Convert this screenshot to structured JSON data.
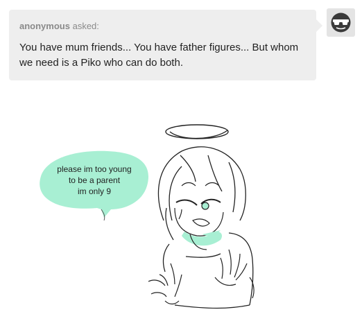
{
  "ask": {
    "asker": "anonymous",
    "asked_label": "asked:",
    "question": "You have mum friends... You have father figures... But whom we need is a Piko who can do both."
  },
  "answer": {
    "speech_lines": [
      "please im too young",
      "to be a parent",
      "im only 9"
    ]
  },
  "colors": {
    "ask_background": "#eeeeee",
    "accent_mint": "#a8efd3"
  },
  "icons": {
    "avatar": "anonymous-sunglasses-avatar-icon"
  }
}
